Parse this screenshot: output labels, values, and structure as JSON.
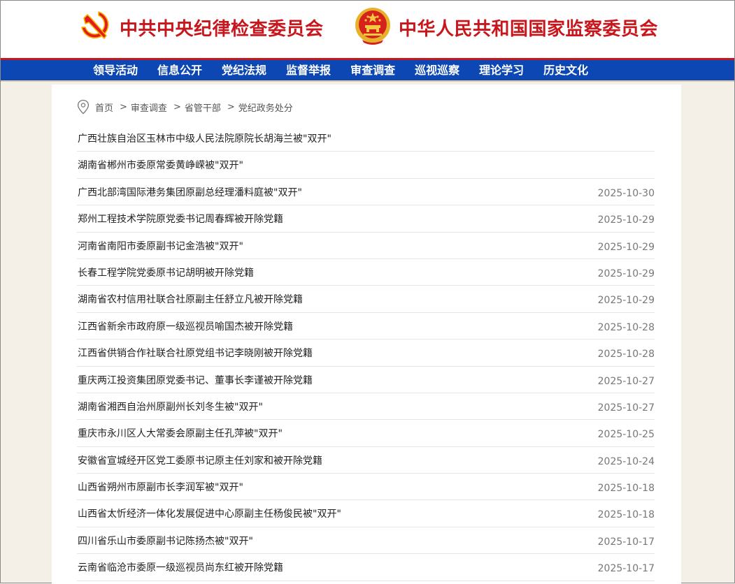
{
  "header": {
    "ccdi_name": "中共中央纪律检查委员会",
    "nsc_name": "中华人民共和国国家监察委员会"
  },
  "nav": {
    "items": [
      "领导活动",
      "信息公开",
      "党纪法规",
      "监督举报",
      "审查调查",
      "巡视巡察",
      "理论学习",
      "历史文化"
    ]
  },
  "breadcrumb": {
    "items": [
      "首页",
      "审查调查",
      "省管干部",
      "党纪政务处分"
    ],
    "separator": ">"
  },
  "articles": [
    {
      "title": "广西壮族自治区玉林市中级人民法院原院长胡海兰被\"双开\"",
      "date": ""
    },
    {
      "title": "湖南省郴州市委原常委黄峥嵘被\"双开\"",
      "date": ""
    },
    {
      "title": "广西北部湾国际港务集团原副总经理潘料庭被\"双开\"",
      "date": "2025-10-30"
    },
    {
      "title": "郑州工程技术学院原党委书记周春辉被开除党籍",
      "date": "2025-10-29"
    },
    {
      "title": "河南省南阳市委原副书记金浩被\"双开\"",
      "date": "2025-10-29"
    },
    {
      "title": "长春工程学院党委原书记胡明被开除党籍",
      "date": "2025-10-29"
    },
    {
      "title": "湖南省农村信用社联合社原副主任舒立凡被开除党籍",
      "date": "2025-10-29"
    },
    {
      "title": "江西省新余市政府原一级巡视员喻国杰被开除党籍",
      "date": "2025-10-28"
    },
    {
      "title": "江西省供销合作社联合社原党组书记李晓刚被开除党籍",
      "date": "2025-10-28"
    },
    {
      "title": "重庆两江投资集团原党委书记、董事长李谨被开除党籍",
      "date": "2025-10-27"
    },
    {
      "title": "湖南省湘西自治州原副州长刘冬生被\"双开\"",
      "date": "2025-10-27"
    },
    {
      "title": "重庆市永川区人大常委会原副主任孔萍被\"双开\"",
      "date": "2025-10-25"
    },
    {
      "title": "安徽省宣城经开区党工委原书记原主任刘家和被开除党籍",
      "date": "2025-10-24"
    },
    {
      "title": "山西省朔州市原副市长李润军被\"双开\"",
      "date": "2025-10-18"
    },
    {
      "title": "山西省太忻经济一体化发展促进中心原副主任杨俊民被\"双开\"",
      "date": "2025-10-18"
    },
    {
      "title": "四川省乐山市委原副书记陈扬杰被\"双开\"",
      "date": "2025-10-17"
    },
    {
      "title": "云南省临沧市委原一级巡视员尚东红被开除党籍",
      "date": "2025-10-17"
    }
  ],
  "icons": {
    "party_emblem": "hammer-sickle-icon",
    "national_emblem": "national-emblem-icon",
    "location": "location-pin-icon"
  },
  "colors": {
    "brand_red": "#c8161d",
    "nav_blue": "#0d47b3",
    "page_bg": "#f4efe7"
  }
}
